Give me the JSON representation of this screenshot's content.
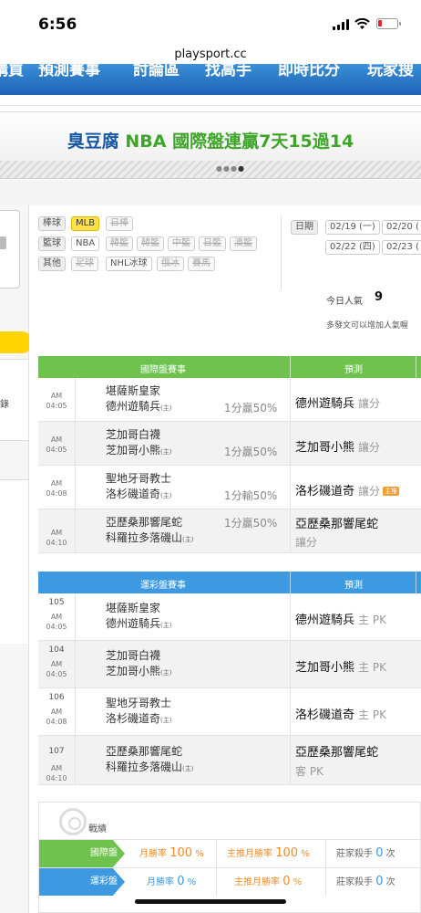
{
  "status": {
    "time": "6:56"
  },
  "browser": {
    "url": "playsport.cc"
  },
  "nav": {
    "items": [
      "購買",
      "預測賽事",
      "討論區",
      "找高手",
      "即時比分",
      "玩家搜"
    ]
  },
  "banner": {
    "part1": "臭豆腐",
    "part2": "NBA 國際盤連贏7天15過14"
  },
  "filters": {
    "row1": {
      "cat": "棒球",
      "opts": [
        "MLB",
        "日棒"
      ]
    },
    "row2": {
      "cat": "籃球",
      "opts": [
        "NBA",
        "韓籃",
        "韓籃",
        "中籃",
        "日籃",
        "澳籃"
      ]
    },
    "row3": {
      "cat": "其他",
      "opts": [
        "足球",
        "NHL冰球",
        "俄冰",
        "賽馬"
      ]
    }
  },
  "dates": {
    "label": "日期",
    "items": [
      "02/19 (一)",
      "02/20 (",
      "02/22 (四)",
      "02/23 ("
    ]
  },
  "popularity": {
    "label": "今日人氣",
    "value": "9",
    "note": "多發文可以增加人氣喔"
  },
  "intl": {
    "header": {
      "match": "國際盤賽事",
      "pred": "預測"
    },
    "rows": [
      {
        "ampm": "AM",
        "time": "04:05",
        "away": "堪薩斯皇家",
        "home": "德州遊騎兵",
        "home_tag": "(主)",
        "odds": "1分贏50%",
        "pick": "德州遊騎兵",
        "pick_type": "讓分"
      },
      {
        "ampm": "AM",
        "time": "04:05",
        "away": "芝加哥白襪",
        "home": "芝加哥小熊",
        "home_tag": "(主)",
        "odds": "1分贏50%",
        "pick": "芝加哥小熊",
        "pick_type": "讓分"
      },
      {
        "ampm": "AM",
        "time": "04:08",
        "away": "聖地牙哥教士",
        "home": "洛杉磯道奇",
        "home_tag": "(主)",
        "odds": "1分輸50%",
        "pick": "洛杉磯道奇",
        "pick_type": "讓分",
        "badge": "主推"
      },
      {
        "ampm": "AM",
        "time": "04:10",
        "away": "亞歷桑那響尾蛇",
        "home": "科羅拉多落磯山",
        "home_tag": "(主)",
        "odds": "1分贏50%",
        "pick": "亞歷桑那響尾蛇",
        "pick_type": "讓分"
      }
    ]
  },
  "lottery": {
    "header": {
      "match": "運彩盤賽事",
      "pred": "預測"
    },
    "rows": [
      {
        "num": "105",
        "ampm": "AM",
        "time": "04:05",
        "away": "堪薩斯皇家",
        "home": "德州遊騎兵",
        "home_tag": "(主)",
        "pick": "德州遊騎兵",
        "pick_type": "主 PK"
      },
      {
        "num": "104",
        "ampm": "AM",
        "time": "04:05",
        "away": "芝加哥白襪",
        "home": "芝加哥小熊",
        "home_tag": "(主)",
        "pick": "芝加哥小熊",
        "pick_type": "主 PK"
      },
      {
        "num": "106",
        "ampm": "AM",
        "time": "04:08",
        "away": "聖地牙哥教士",
        "home": "洛杉磯道奇",
        "home_tag": "(主)",
        "pick": "洛杉磯道奇",
        "pick_type": "主 PK"
      },
      {
        "num": "107",
        "ampm": "AM",
        "time": "04:10",
        "away": "亞歷桑那響尾蛇",
        "home": "科羅拉多落磯山",
        "home_tag": "(主)",
        "pick": "亞歷桑那響尾蛇",
        "pick_type": "客 PK"
      }
    ]
  },
  "record": {
    "title": "戰績",
    "rows": [
      {
        "label": "國際盤",
        "win_label": "月勝率",
        "win": "100",
        "unit": "%",
        "main_label": "主推月勝率",
        "main": "100",
        "killer_label": "莊家殺手",
        "killer": "0",
        "killer_unit": "次"
      },
      {
        "label": "運彩盤",
        "win_label": "月勝率",
        "win": "0",
        "unit": "%",
        "main_label": "主推月勝率",
        "main": "0",
        "killer_label": "莊家殺手",
        "killer": "0",
        "killer_unit": "次"
      }
    ]
  },
  "colors": {
    "green": "#6fc24e",
    "blue": "#3d9ae0",
    "nav": "#1d63b5",
    "yellow": "#ffd400",
    "orange": "#f08c2a"
  }
}
